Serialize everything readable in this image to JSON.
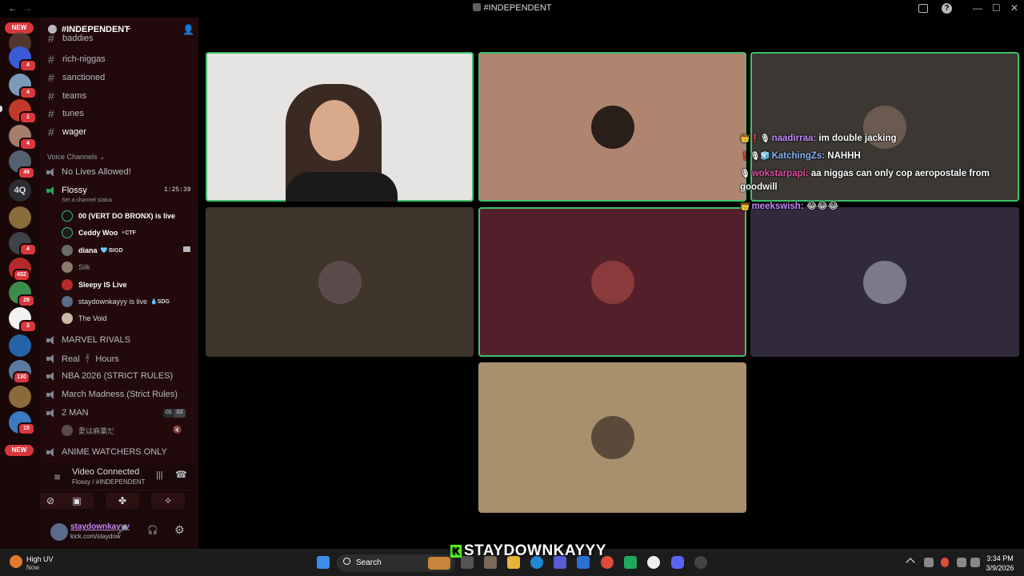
{
  "window": {
    "title": "#INDEPENDENT",
    "back": "←",
    "forward": "→",
    "minimize": "—",
    "maximize": "☐",
    "close": "✕",
    "help": "?"
  },
  "rail": {
    "new_top": "NEW",
    "new_bottom": "NEW",
    "text_server": "4Q",
    "badges": [
      "4",
      "4",
      "1",
      "4",
      "49",
      "4",
      "432",
      "29",
      "3",
      "130",
      "15"
    ]
  },
  "sidebar": {
    "guild_name": "#INDEPENDENT",
    "partial_channel": "baddies",
    "text_channels": [
      "rich-niggas",
      "sanctioned",
      "teams",
      "tunes",
      "wager"
    ],
    "voice_header": "Voice Channels",
    "voice_channels": {
      "no_lives": "No Lives Allowed!",
      "flossy": "Flossy",
      "flossy_timer": "1:25:39",
      "flossy_status": "Set a channel status",
      "marvel": "MARVEL RIVALS",
      "real_hours": "Real 🕴🏿 Hours",
      "nba": "NBA 2026 (STRICT RULES)",
      "march": "March Madness (Strict Rules)",
      "two_man": "2 MAN",
      "two_man_count_a": "01",
      "two_man_count_b": "02",
      "two_man_member": "愛は麻薬だ",
      "anime": "ANIME WATCHERS ONLY"
    },
    "members": [
      {
        "name": "00 (VERT DO BRONX) is live",
        "tag": ""
      },
      {
        "name": "Ceddy Woo",
        "tag": "⚡CTF"
      },
      {
        "name": "diana",
        "tag": "🩵 BIGD"
      },
      {
        "name": "Silk",
        "tag": ""
      },
      {
        "name": "Sleepy IS Live",
        "tag": ""
      },
      {
        "name": "staydownkayyy is live",
        "tag": "💧SDG"
      },
      {
        "name": "The Void",
        "tag": ""
      }
    ]
  },
  "voice_panel": {
    "status": "Video Connected",
    "location": "Flossy / #INDEPENDENT"
  },
  "user_panel": {
    "username": "staydownkayyy",
    "status": "kick.com/staydow"
  },
  "chat": [
    {
      "badges": "👑❗🎙",
      "name": "naadirraa:",
      "text": "im double jacking"
    },
    {
      "badges": "❗🎙🧊",
      "name": "KatchingZs:",
      "text": "NAHHH"
    },
    {
      "badges": "🎙",
      "name": "wokstarpapi:",
      "text": "aa niggas can only cop aeropostale from"
    },
    {
      "badges": "",
      "name": "",
      "text": "goodwill"
    },
    {
      "badges": "👑",
      "name": "meekswish:",
      "text": "😂😂😂"
    }
  ],
  "watermark": "STAYDOWNKAYYY",
  "taskbar": {
    "weather_title": "High UV",
    "weather_sub": "Now",
    "search": "Search",
    "time": "3:34 PM",
    "date": "3/9/2026"
  }
}
